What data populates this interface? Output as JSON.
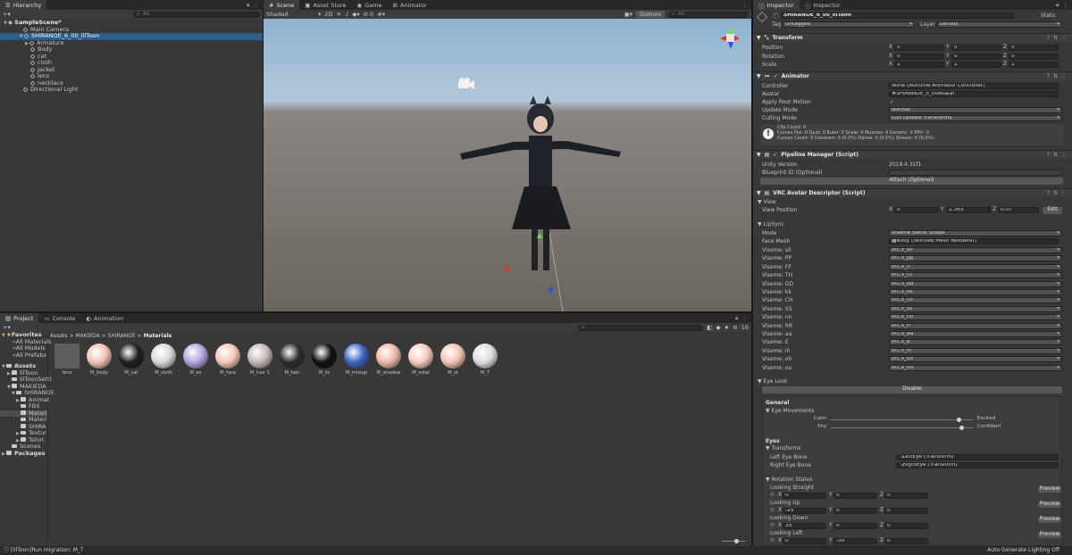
{
  "hierarchy": {
    "title": "Hierarchy",
    "search": "All",
    "scene": "SampleScene*",
    "items": [
      "Main Camera",
      "SHIRANOE_6_00_lilToon",
      "Armature",
      "Body",
      "cat",
      "cloth",
      "Jacket",
      "lenz",
      "necklace",
      "Directional Light"
    ]
  },
  "scene_tabs": [
    "Scene",
    "Asset Store",
    "Game",
    "Animator"
  ],
  "scene_toolbar": {
    "shading": "Shaded",
    "mode": "2D",
    "gizmos": "Gizmos",
    "search": "All"
  },
  "project": {
    "tabs": [
      "Project",
      "Console",
      "Animation"
    ],
    "favorites": [
      "Favorites",
      "All Materials",
      "All Models",
      "All Prefabs"
    ],
    "assets": [
      "Assets",
      "lilToon",
      "lilToonSetti",
      "MAKIEDA",
      "SHIRANOE",
      "Animat",
      "FBX",
      "Materi",
      "Materi",
      "SHIRA",
      "Textur",
      "Tshirt",
      "Scenes",
      "Packages"
    ],
    "breadcrumb": [
      "Assets",
      "MAKIEDA",
      "SHIRANOE",
      "Materials"
    ],
    "count": "16",
    "materials": [
      {
        "name": "lenz",
        "color": "#5e5e5e"
      },
      {
        "name": "M_body",
        "color": "#f2c4b2"
      },
      {
        "name": "M_cat",
        "color": "#202020"
      },
      {
        "name": "M_cloth",
        "color": "#d8d8d8"
      },
      {
        "name": "M_ex",
        "color": "#b6a4e2"
      },
      {
        "name": "M_face",
        "color": "#f4c8b8"
      },
      {
        "name": "M_hair 1",
        "color": "#cab8b8"
      },
      {
        "name": "M_hair",
        "color": "#2e2e2e"
      },
      {
        "name": "M_iis",
        "color": "#111111"
      },
      {
        "name": "M_mizugi",
        "color": "#3c66c4"
      },
      {
        "name": "M_shadow",
        "color": "#efb9a6"
      },
      {
        "name": "M_sotai",
        "color": "#f6cdbc"
      },
      {
        "name": "M_st",
        "color": "#f3c3b1"
      },
      {
        "name": "M_T",
        "color": "#dddddd"
      }
    ]
  },
  "inspector": {
    "tabs": [
      "Inspector",
      "Inspector"
    ],
    "object_name": "SHIRANOE_6_00_lilToon",
    "static": "Static",
    "tag_label": "Tag",
    "tag": "Untagged",
    "layer_label": "Layer",
    "layer": "Default",
    "transform": {
      "title": "Transform",
      "rows": [
        {
          "label": "Position",
          "x": "0",
          "y": "0",
          "z": "0"
        },
        {
          "label": "Rotation",
          "x": "0",
          "y": "0",
          "z": "0"
        },
        {
          "label": "Scale",
          "x": "1",
          "y": "1",
          "z": "1"
        }
      ]
    },
    "animator": {
      "title": "Animator",
      "controller_label": "Controller",
      "controller": "None (Runtime Animator Controller)",
      "avatar_label": "Avatar",
      "avatar": "SHIRANOE_5_00Avatar",
      "root_motion": "Apply Root Motion",
      "update_label": "Update Mode",
      "update": "Normal",
      "culling_label": "Culling Mode",
      "culling": "Cull Update Transforms",
      "info1": "Clip Count: 0",
      "info2": "Curves Pos: 0 Quat: 0 Euler: 0 Scale: 0 Muscles: 0 Generic: 0 PPtr: 0",
      "info3": "Curves Count: 0 Constant: 0 (0.0%) Dense: 0 (0.0%) Stream: 0 (0.0%)"
    },
    "pipeline": {
      "title": "Pipeline Manager (Script)",
      "unity_label": "Unity Version",
      "unity": "2019.4.31f1",
      "blueprint": "Blueprint ID (Optional)",
      "attach": "Attach (Optional)"
    },
    "vrc": {
      "title": "VRC Avatar Descriptor (Script)",
      "view": "View",
      "view_pos": "View Position",
      "vx": "0",
      "vy": "1.363",
      "vz": "0.07",
      "edit": "Edit",
      "lipsync": "LipSync",
      "mode_label": "Mode",
      "mode": "Viseme Blend Shape",
      "face_label": "Face Mesh",
      "face": "Body (Skinned Mesh Renderer)",
      "visemes": [
        {
          "label": "Viseme: sil",
          "value": "vrc.v_sil"
        },
        {
          "label": "Viseme: PP",
          "value": "vrc.v_pp"
        },
        {
          "label": "Viseme: FF",
          "value": "vrc.v_ff"
        },
        {
          "label": "Viseme: TH",
          "value": "vrc.v_th"
        },
        {
          "label": "Viseme: DD",
          "value": "vrc.v_dd"
        },
        {
          "label": "Viseme: kk",
          "value": "vrc.v_kk"
        },
        {
          "label": "Viseme: CH",
          "value": "vrc.v_ch"
        },
        {
          "label": "Viseme: SS",
          "value": "vrc.v_ss"
        },
        {
          "label": "Viseme: nn",
          "value": "vrc.v_nn"
        },
        {
          "label": "Viseme: RR",
          "value": "vrc.v_rr"
        },
        {
          "label": "Viseme: aa",
          "value": "vrc.v_aa"
        },
        {
          "label": "Viseme: E",
          "value": "vrc.v_e"
        },
        {
          "label": "Viseme: ih",
          "value": "vrc.v_ih"
        },
        {
          "label": "Viseme: oh",
          "value": "vrc.v_oh"
        },
        {
          "label": "Viseme: ou",
          "value": "vrc.v_ou"
        }
      ],
      "eyelook": "Eye Look",
      "disable": "Disable",
      "general": "General",
      "eye_movements": "Eye Movements",
      "calm": "Calm",
      "excited": "Excited",
      "shy": "Shy",
      "confident": "Confident",
      "calm_level": 0.9,
      "shy_level": 0.92,
      "eyes": "Eyes",
      "transforms": "Transforms",
      "left_label": "Left Eye Bone",
      "left": "LeftEye (Transform)",
      "right_label": "Right Eye Bone",
      "right": "RightEye (Transform)",
      "rotation_states": "Rotation States",
      "preview": "Preview",
      "states": [
        {
          "label": "Looking Straight",
          "x": "0",
          "y": "0",
          "z": "0"
        },
        {
          "label": "Looking Up",
          "x": "-25",
          "y": "0",
          "z": "0"
        },
        {
          "label": "Looking Down",
          "x": "35",
          "y": "0",
          "z": "0"
        },
        {
          "label": "Looking Left",
          "x": "0",
          "y": "-30",
          "z": "0"
        }
      ]
    }
  },
  "status": {
    "message": "[lilToon]Run migration: M_T",
    "right": "Auto Generate Lighting Off"
  }
}
